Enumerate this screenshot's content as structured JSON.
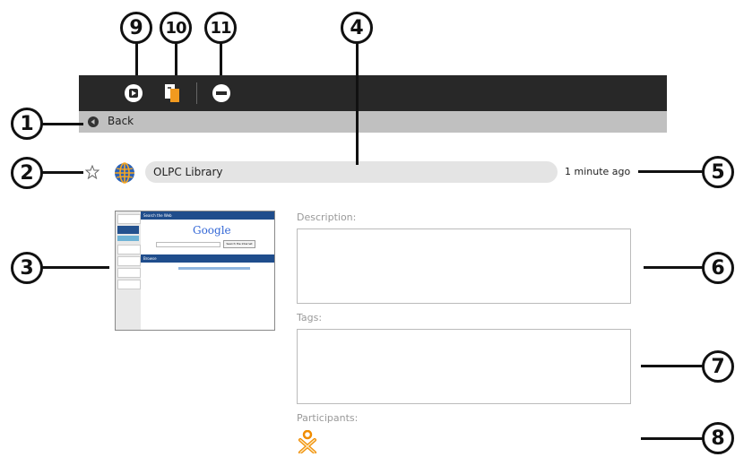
{
  "callouts": [
    "1",
    "2",
    "3",
    "4",
    "5",
    "6",
    "7",
    "8",
    "9",
    "10",
    "11"
  ],
  "toolbar": {
    "buttons": [
      {
        "icon": "resume-icon"
      },
      {
        "icon": "copy-to-icon"
      },
      {
        "icon": "erase-icon"
      }
    ]
  },
  "back": {
    "label": "Back"
  },
  "entry": {
    "title": "OLPC Library",
    "timestamp": "1 minute ago",
    "activity_icon": "globe-icon",
    "favorite_icon": "star-icon"
  },
  "fields": {
    "description_label": "Description:",
    "tags_label": "Tags:",
    "participants_label": "Participants:"
  },
  "preview": {
    "sidebar_items": [
      "",
      "",
      "",
      "",
      "",
      ""
    ],
    "search_header": "Search the Web",
    "logo": "Google",
    "search_button": "Search the Internet",
    "browse_header": "Browse"
  },
  "colors": {
    "toolbar_bg": "#282828",
    "backbar_bg": "#c0c0c0",
    "globe_blue": "#2b62b7",
    "participant_orange": "#f08c00"
  }
}
